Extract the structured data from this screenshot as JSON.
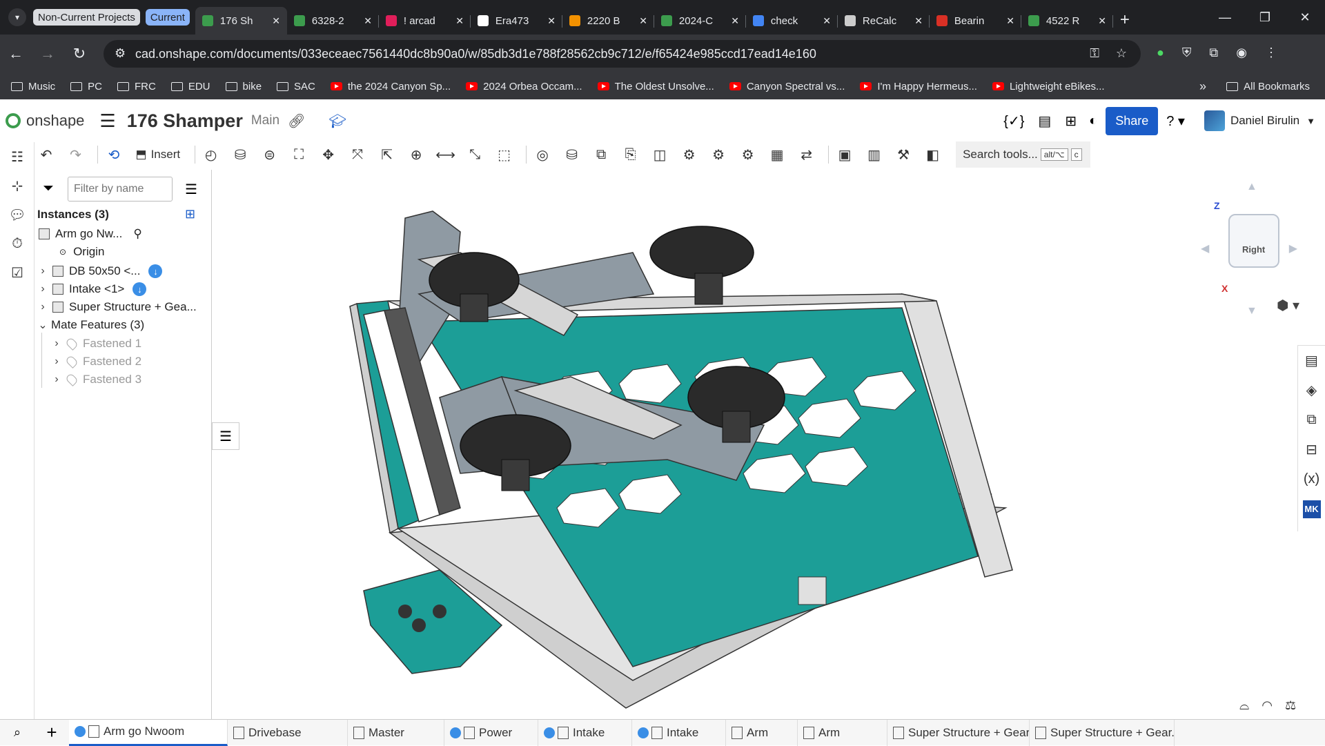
{
  "browser": {
    "groups": [
      {
        "label": "Non-Current Projects",
        "bg": "#dadce0",
        "fg": "#202124"
      },
      {
        "label": "Current",
        "bg": "#8ab4f8",
        "fg": "#202124"
      }
    ],
    "tabs": [
      {
        "title": "176 Sh",
        "icon": "onshape-icon",
        "color": "#3c9c4d",
        "active": true
      },
      {
        "title": "6328-2",
        "icon": "onshape-icon",
        "color": "#3c9c4d"
      },
      {
        "title": "! arcad",
        "icon": "slack-icon",
        "color": "#e01e5a"
      },
      {
        "title": "Era473",
        "icon": "github-icon",
        "color": "#ffffff"
      },
      {
        "title": "2220 B",
        "icon": "cd-icon",
        "color": "#f29100"
      },
      {
        "title": "2024-C",
        "icon": "onshape-icon",
        "color": "#3c9c4d"
      },
      {
        "title": "check",
        "icon": "google-icon",
        "color": "#4285f4"
      },
      {
        "title": "ReCalc",
        "icon": "recalc-icon",
        "color": "#cccccc"
      },
      {
        "title": "Bearin",
        "icon": "gmail-icon",
        "color": "#d93025"
      },
      {
        "title": "4522 R",
        "icon": "onshape-icon",
        "color": "#3c9c4d"
      }
    ],
    "url": "cad.onshape.com/documents/033eceaec7561440dc8b90a0/w/85db3d1e788f28562cb9c712/e/f65424e985ccd17ead14e160",
    "bookmarks": [
      {
        "label": "Music",
        "type": "folder"
      },
      {
        "label": "PC",
        "type": "folder"
      },
      {
        "label": "FRC",
        "type": "folder"
      },
      {
        "label": "EDU",
        "type": "folder"
      },
      {
        "label": "bike",
        "type": "folder"
      },
      {
        "label": "SAC",
        "type": "folder"
      },
      {
        "label": "the 2024 Canyon Sp...",
        "type": "youtube"
      },
      {
        "label": "2024 Orbea Occam...",
        "type": "youtube"
      },
      {
        "label": "The Oldest Unsolve...",
        "type": "youtube"
      },
      {
        "label": "Canyon Spectral vs...",
        "type": "youtube"
      },
      {
        "label": "I'm Happy Hermeus...",
        "type": "youtube"
      },
      {
        "label": "Lightweight eBikes...",
        "type": "youtube"
      }
    ],
    "all_bookmarks": "All Bookmarks"
  },
  "app": {
    "logo": "onshape",
    "doc_title": "176 Shamper",
    "branch": "Main",
    "share": "Share",
    "user": "Daniel Birulin",
    "insert": "Insert",
    "search_tools": "Search tools...",
    "search_kbd1": "alt/⌥",
    "search_kbd2": "c"
  },
  "panel": {
    "filter_placeholder": "Filter by name",
    "instances_header": "Instances (3)",
    "arm": "Arm go Nw...",
    "origin": "Origin",
    "items": [
      {
        "label": "DB 50x50 <...",
        "download": true
      },
      {
        "label": "Intake <1>",
        "download": true
      },
      {
        "label": "Super Structure + Gea...",
        "download": false
      }
    ],
    "mates_header": "Mate Features (3)",
    "mates": [
      "Fastened 1",
      "Fastened 2",
      "Fastened 3"
    ]
  },
  "viewcube": {
    "top_label": "Right",
    "axis_z": "Z",
    "axis_x": "X"
  },
  "bottom_tabs": [
    {
      "label": "Arm go Nwoom",
      "download": true,
      "active": true
    },
    {
      "label": "Drivebase",
      "download": false,
      "folder": true
    },
    {
      "label": "Master",
      "download": false
    },
    {
      "label": "Power",
      "download": true
    },
    {
      "label": "Intake",
      "download": true
    },
    {
      "label": "Intake",
      "download": true
    },
    {
      "label": "Arm",
      "download": false
    },
    {
      "label": "Arm",
      "download": false
    },
    {
      "label": "Super Structure + Gear...",
      "download": false
    },
    {
      "label": "Super Structure + Gear...",
      "download": false
    }
  ],
  "colors": {
    "accent": "#1a5cc8",
    "teal": "#1c9e97",
    "chrome_dark": "#202124"
  }
}
